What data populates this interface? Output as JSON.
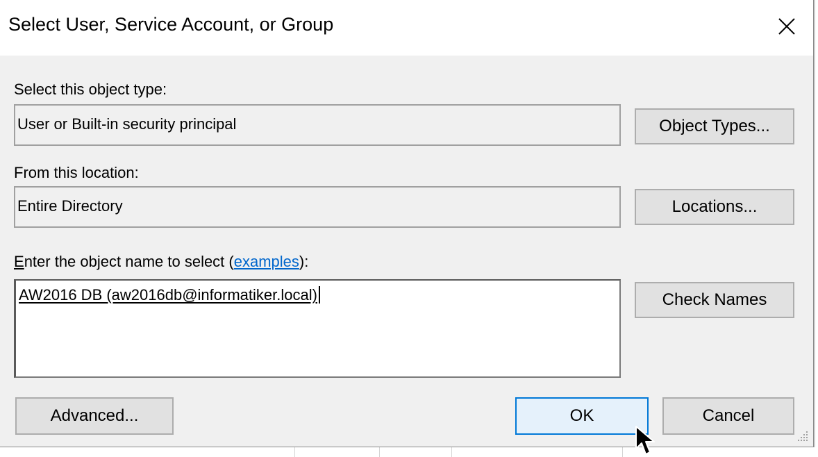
{
  "dialog": {
    "title": "Select User, Service Account, or Group"
  },
  "object_type": {
    "label": "Select this object type:",
    "value": "User or Built-in security principal",
    "button": "Object Types..."
  },
  "location": {
    "label": "From this location:",
    "value": "Entire Directory",
    "button": "Locations..."
  },
  "object_name": {
    "label_prefix": "E",
    "label_main": "nter the object name to select (",
    "link": "examples",
    "label_suffix": "):",
    "value": "AW2016 DB (aw2016db@informatiker.local)",
    "check_button": "Check Names"
  },
  "footer": {
    "advanced": "Advanced...",
    "ok": "OK",
    "cancel": "Cancel"
  },
  "icons": {
    "close": "close-icon",
    "grip": "resize-grip-icon",
    "cursor": "mouse-cursor-icon"
  },
  "colors": {
    "accent": "#0078d7",
    "link": "#0066cc",
    "dialog_bg": "#f0f0f0"
  }
}
